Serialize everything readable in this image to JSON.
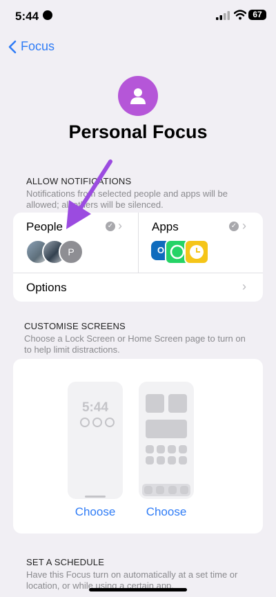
{
  "status_bar": {
    "time": "5:44",
    "battery": "67"
  },
  "nav": {
    "back_label": "Focus"
  },
  "header": {
    "title": "Personal Focus"
  },
  "allow_notifications": {
    "heading": "ALLOW NOTIFICATIONS",
    "desc_line1": "Notifications from selected people and apps will be",
    "desc_line2": "allowed; all others will be silenced.",
    "people_label": "People",
    "people_avatar_initial": "P",
    "apps_label": "Apps",
    "options_label": "Options"
  },
  "customise": {
    "heading": "CUSTOMISE SCREENS",
    "desc_line1": "Choose a Lock Screen or Home Screen page to turn on",
    "desc_line2": "to help limit distractions.",
    "lock_time": "5:44",
    "choose_lock": "Choose",
    "choose_home": "Choose"
  },
  "schedule": {
    "heading": "SET A SCHEDULE",
    "desc_line1": "Have this Focus turn on automatically at a set time or",
    "desc_line2": "location, or while using a certain app."
  },
  "colors": {
    "accent": "#2f7cf6",
    "focus_purple": "#b556d8",
    "annotation_arrow": "#9b4be0"
  }
}
